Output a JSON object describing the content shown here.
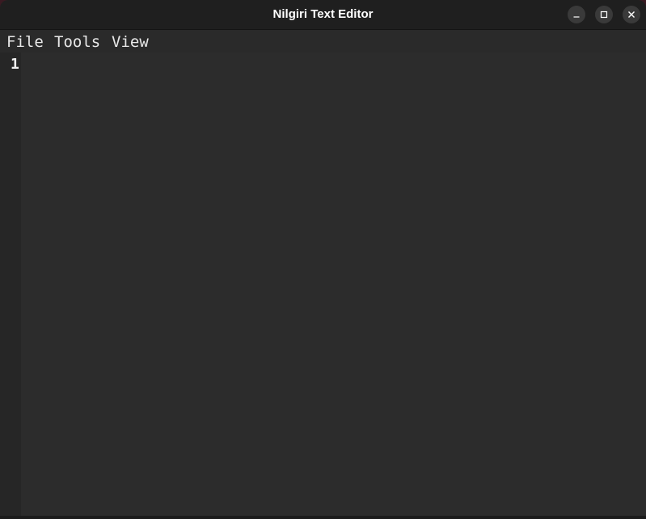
{
  "window": {
    "title": "Nilgiri Text Editor"
  },
  "controls": {
    "minimize_icon": "minimize-icon",
    "maximize_icon": "maximize-icon",
    "close_icon": "close-icon"
  },
  "menubar": {
    "items": [
      {
        "label": "File"
      },
      {
        "label": "Tools"
      },
      {
        "label": "View"
      }
    ]
  },
  "editor": {
    "line_numbers": [
      "1"
    ],
    "content": ""
  },
  "colors": {
    "titlebar": "#1f1f1f",
    "background": "#2a2a2a",
    "gutter": "#262626",
    "text": "#e8e8e8"
  }
}
